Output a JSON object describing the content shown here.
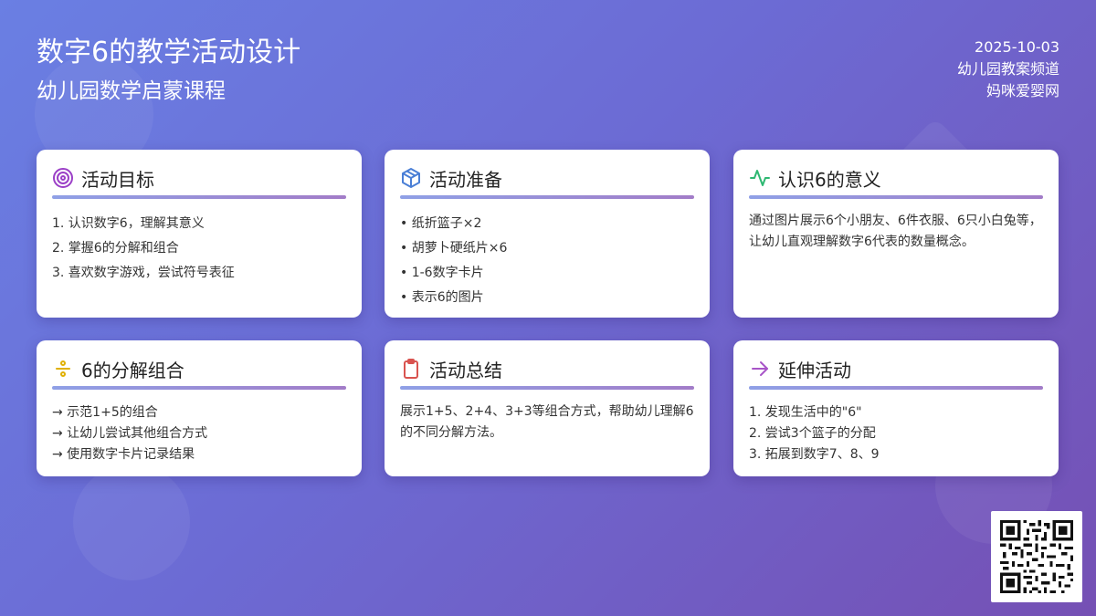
{
  "header": {
    "title": "数字6的教学活动设计",
    "subtitle": "幼儿园数学启蒙课程",
    "date": "2025-10-03",
    "channel": "幼儿园教案频道",
    "site": "妈咪爱婴网"
  },
  "cards": [
    {
      "icon": "target-icon",
      "title": "活动目标",
      "items": [
        "1. 认识数字6，理解其意义",
        "2. 掌握6的分解和组合",
        "3. 喜欢数字游戏，尝试符号表征"
      ]
    },
    {
      "icon": "box-icon",
      "title": "活动准备",
      "items": [
        "• 纸折篮子×2",
        "• 胡萝卜硬纸片×6",
        "• 1-6数字卡片",
        "• 表示6的图片"
      ]
    },
    {
      "icon": "pulse-icon",
      "title": "认识6的意义",
      "text": "通过图片展示6个小朋友、6件衣服、6只小白兔等，让幼儿直观理解数字6代表的数量概念。"
    },
    {
      "icon": "divide-icon",
      "title": "6的分解组合",
      "items": [
        "→ 示范1+5的组合",
        "→ 让幼儿尝试其他组合方式",
        "→ 使用数字卡片记录结果"
      ]
    },
    {
      "icon": "clipboard-icon",
      "title": "活动总结",
      "text": "展示1+5、2+4、3+3等组合方式，帮助幼儿理解6的不同分解方法。"
    },
    {
      "icon": "arrow-right-icon",
      "title": "延伸活动",
      "items": [
        "1. 发现生活中的\"6\"",
        "2. 尝试3个篮子的分配",
        "3. 拓展到数字7、8、9"
      ]
    }
  ],
  "colors": {
    "target": "#9b3fc7",
    "box": "#4a7fd6",
    "pulse": "#2eb872",
    "divide": "#e0b000",
    "clipboard": "#d9534f",
    "arrow": "#a855c8"
  },
  "qr": {
    "icon": "qr-code-icon"
  }
}
